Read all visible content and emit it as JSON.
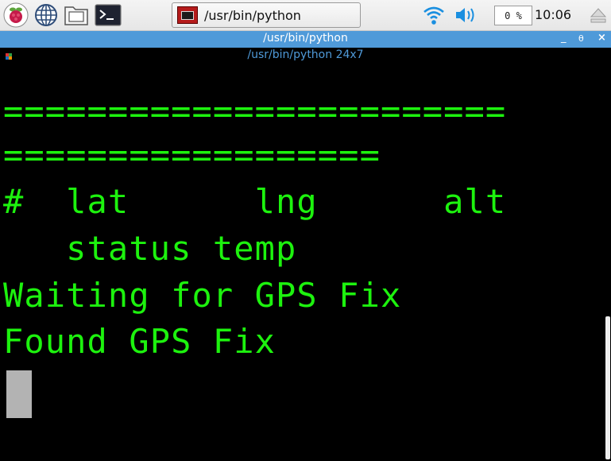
{
  "taskbar": {
    "launchers": [
      {
        "name": "raspberry-menu-icon"
      },
      {
        "name": "web-browser-globe-icon"
      },
      {
        "name": "file-manager-folder-icon"
      },
      {
        "name": "terminal-icon"
      }
    ],
    "task_button_label": "/usr/bin/python",
    "cpu_usage": "0 %",
    "clock": "10:06"
  },
  "window": {
    "title": "/usr/bin/python",
    "controls": [
      "_",
      "θ",
      "×"
    ]
  },
  "terminal": {
    "subtitle": "/usr/bin/python 24x7",
    "lines": [
      "========================",
      "==================",
      "#  lat      lng      alt",
      "   status temp",
      "Waiting for GPS Fix",
      "Found GPS Fix"
    ],
    "text_color": "#1df20e",
    "background": "#000000"
  },
  "colors": {
    "titlebar": "#4f9ad9",
    "cursor": "#b3b3b3"
  }
}
